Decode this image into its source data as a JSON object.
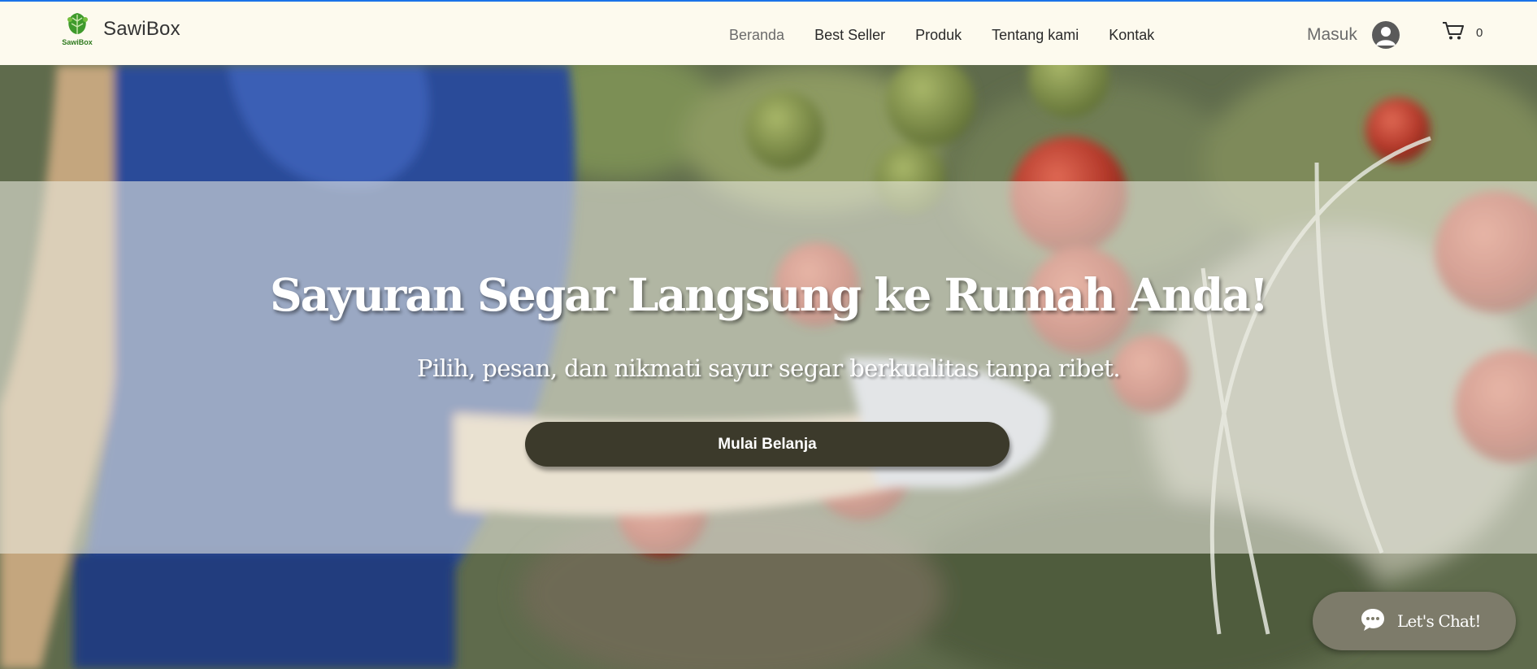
{
  "header": {
    "brand": "SawiBox",
    "logo_text": "SawiBox",
    "nav": [
      {
        "label": "Beranda",
        "active": true
      },
      {
        "label": "Best Seller"
      },
      {
        "label": "Produk"
      },
      {
        "label": "Tentang kami"
      },
      {
        "label": "Kontak"
      }
    ],
    "login_label": "Masuk",
    "cart_count": "0",
    "icons": {
      "avatar": "user-avatar-icon",
      "cart": "shopping-cart-icon"
    }
  },
  "hero": {
    "headline": "Sayuran Segar Langsung ke Rumah Anda!",
    "subheadline": "Pilih, pesan, dan nikmati sayur segar berkualitas tanpa ribet.",
    "cta_label": "Mulai Belanja"
  },
  "chat": {
    "label": "Let's Chat!",
    "icon": "chat-bubble-icon"
  },
  "colors": {
    "header_bg": "#fdfaee",
    "cta_bg": "#3c3a2b",
    "chat_bg": "#7d7b6a",
    "logo_green": "#3f9a2c"
  }
}
